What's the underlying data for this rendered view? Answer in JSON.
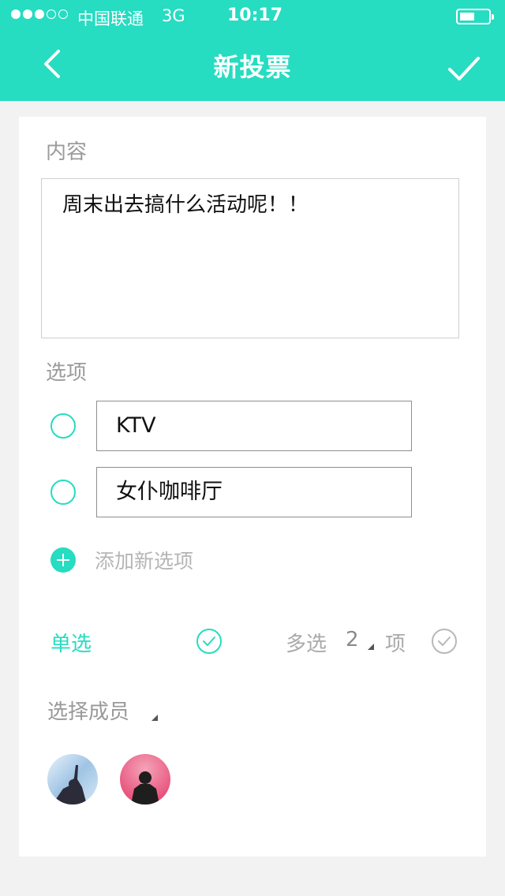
{
  "status_bar": {
    "carrier": "中国联通",
    "network": "3G",
    "time": "10:17",
    "signal_strength": 3,
    "signal_max": 5
  },
  "nav": {
    "title": "新投票",
    "back_icon": "chevron-left-icon",
    "confirm_icon": "checkmark-icon"
  },
  "form": {
    "content_label": "内容",
    "content_text": "周末出去搞什么活动呢！！",
    "options_label": "选项",
    "options": [
      {
        "value": "KTV"
      },
      {
        "value": "女仆咖啡厅"
      }
    ],
    "add_option_label": "添加新选项",
    "single_label": "单选",
    "multi_label": "多选",
    "multi_count": "2",
    "multi_unit": "项",
    "members_label": "选择成员"
  },
  "colors": {
    "accent": "#26dcc1",
    "header_text": "#ffffff",
    "muted": "#9b9b9b"
  }
}
